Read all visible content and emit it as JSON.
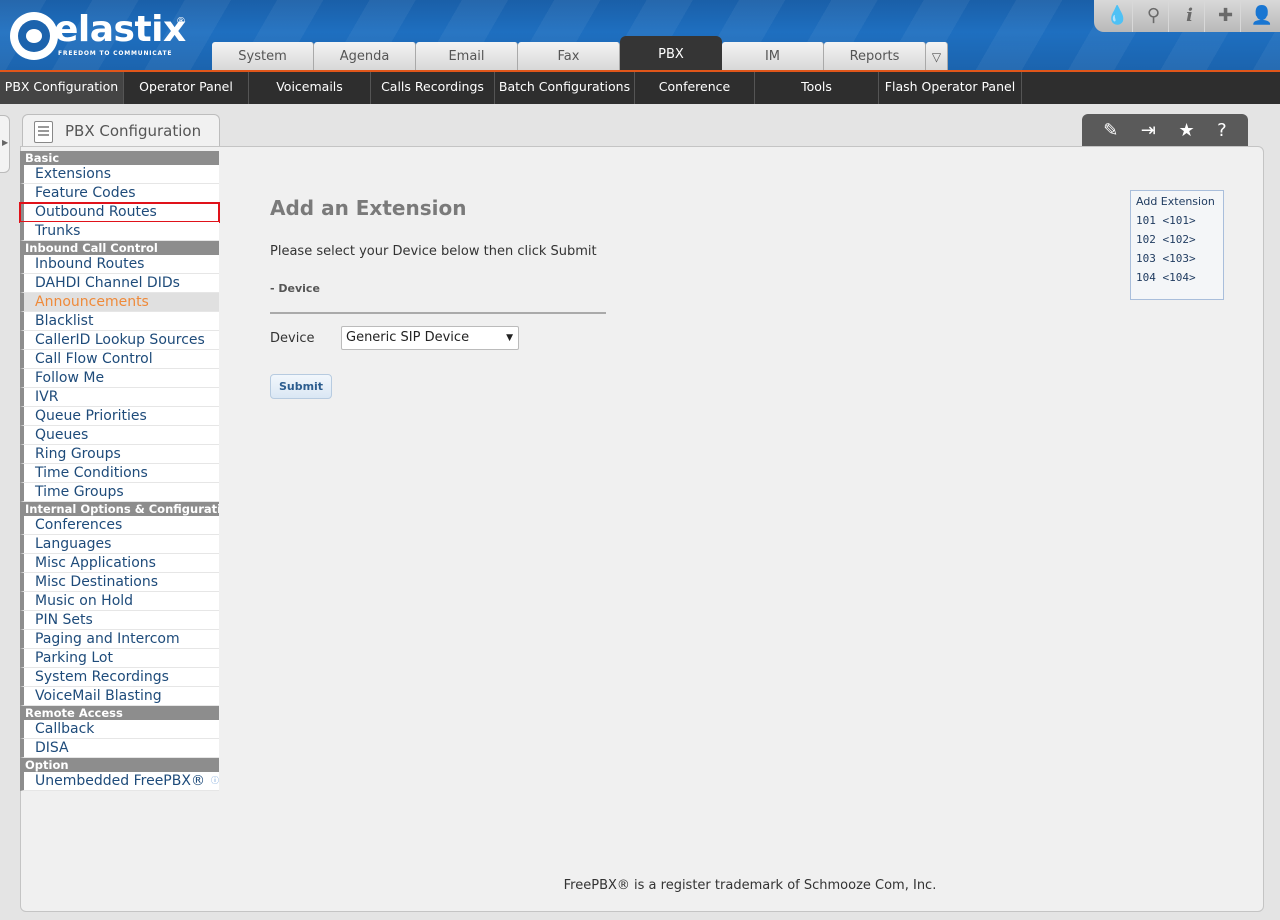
{
  "logo": {
    "word": "elastix",
    "reg": "®",
    "slogan": "FREEDOM TO COMMUNICATE"
  },
  "top_icons": [
    "drop-icon",
    "search-icon",
    "info-icon",
    "puzzle-icon",
    "user-icon"
  ],
  "main_tabs": [
    "System",
    "Agenda",
    "Email",
    "Fax",
    "PBX",
    "IM",
    "Reports"
  ],
  "active_main_tab": "PBX",
  "subnav": [
    "PBX Configuration",
    "Operator Panel",
    "Voicemails",
    "Calls Recordings",
    "Batch Configurations",
    "Conference",
    "Tools",
    "Flash Operator Panel"
  ],
  "module": {
    "title": "PBX Configuration"
  },
  "sidebar": {
    "sections": [
      {
        "header": "Basic",
        "items": [
          "Extensions",
          "Feature Codes",
          "Outbound Routes",
          "Trunks"
        ]
      },
      {
        "header": "Inbound Call Control",
        "items": [
          "Inbound Routes",
          "DAHDI Channel DIDs",
          "Announcements",
          "Blacklist",
          "CallerID Lookup Sources",
          "Call Flow Control",
          "Follow Me",
          "IVR",
          "Queue Priorities",
          "Queues",
          "Ring Groups",
          "Time Conditions",
          "Time Groups"
        ]
      },
      {
        "header": "Internal Options & Configuration",
        "items": [
          "Conferences",
          "Languages",
          "Misc Applications",
          "Misc Destinations",
          "Music on Hold",
          "PIN Sets",
          "Paging and Intercom",
          "Parking Lot",
          "System Recordings",
          "VoiceMail Blasting"
        ]
      },
      {
        "header": "Remote Access",
        "items": [
          "Callback",
          "DISA"
        ]
      },
      {
        "header": "Option",
        "items": [
          "Unembedded FreePBX®"
        ]
      }
    ]
  },
  "content": {
    "title": "Add an Extension",
    "subtitle": "Please select your Device below then click Submit",
    "section": "- Device",
    "device_label": "Device",
    "device_value": "Generic SIP Device",
    "submit": "Submit"
  },
  "right_box": {
    "title": "Add Extension",
    "extensions": [
      "101 <101>",
      "102 <102>",
      "103 <103>",
      "104 <104>"
    ]
  },
  "footer": "FreePBX® is a register trademark of Schmooze Com, Inc."
}
